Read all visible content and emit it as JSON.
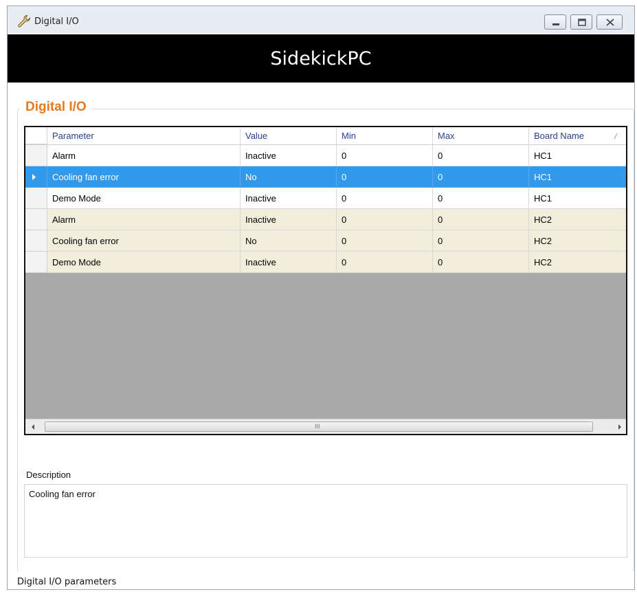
{
  "window": {
    "title": "Digital I/O",
    "icon": "wrench-icon"
  },
  "banner": {
    "title": "SidekickPC"
  },
  "group": {
    "title": "Digital I/O"
  },
  "grid": {
    "columns": [
      "Parameter",
      "Value",
      "Min",
      "Max",
      "Board Name"
    ],
    "rows": [
      {
        "parameter": "Alarm",
        "value": "Inactive",
        "min": "0",
        "max": "0",
        "board": "HC1"
      },
      {
        "parameter": "Cooling fan error",
        "value": "No",
        "min": "0",
        "max": "0",
        "board": "HC1"
      },
      {
        "parameter": "Demo Mode",
        "value": "Inactive",
        "min": "0",
        "max": "0",
        "board": "HC1"
      },
      {
        "parameter": "Alarm",
        "value": "Inactive",
        "min": "0",
        "max": "0",
        "board": "HC2"
      },
      {
        "parameter": "Cooling fan error",
        "value": "No",
        "min": "0",
        "max": "0",
        "board": "HC2"
      },
      {
        "parameter": "Demo Mode",
        "value": "Inactive",
        "min": "0",
        "max": "0",
        "board": "HC2"
      }
    ],
    "selected_row": 1,
    "scroll_grip": "III"
  },
  "description": {
    "label": "Description",
    "text": "Cooling fan error"
  },
  "status": {
    "text": "Digital I/O parameters"
  },
  "colors": {
    "accent": "#e8781a",
    "selection": "#3399ea",
    "alt_row": "#f1efdc",
    "empty_grid": "#a9a9a9",
    "header_text": "#2a3e8f"
  }
}
